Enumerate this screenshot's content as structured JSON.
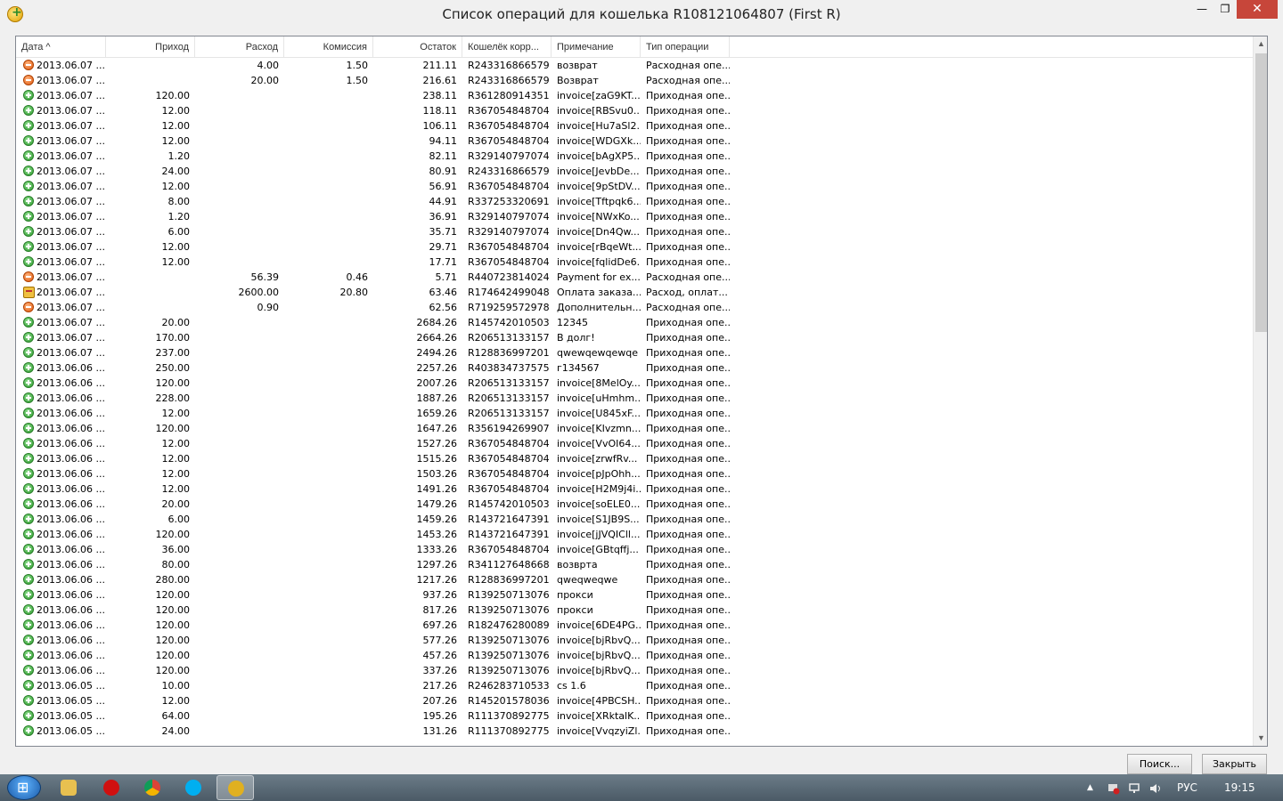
{
  "window": {
    "title": "Список операций для кошелька R108121064807 (First R)",
    "min_glyph": "—",
    "max_glyph": "❐",
    "close_glyph": "✕"
  },
  "columns": {
    "date": "Дата ^",
    "income": "Приход",
    "expense": "Расход",
    "commission": "Комиссия",
    "balance": "Остаток",
    "counterparty": "Кошелёк корр...",
    "note": "Примечание",
    "type": "Тип операции"
  },
  "rows": [
    {
      "icon": "minus",
      "date": "2013.06.07 ...",
      "income": "",
      "expense": "4.00",
      "commission": "1.50",
      "balance": "211.11",
      "wallet": "R243316866579",
      "note": "возврат",
      "type": "Расходная опе..."
    },
    {
      "icon": "minus",
      "date": "2013.06.07 ...",
      "income": "",
      "expense": "20.00",
      "commission": "1.50",
      "balance": "216.61",
      "wallet": "R243316866579",
      "note": "Возврат",
      "type": "Расходная опе..."
    },
    {
      "icon": "plus",
      "date": "2013.06.07 ...",
      "income": "120.00",
      "expense": "",
      "commission": "",
      "balance": "238.11",
      "wallet": "R361280914351",
      "note": "invoice[zaG9KT...",
      "type": "Приходная опе..."
    },
    {
      "icon": "plus",
      "date": "2013.06.07 ...",
      "income": "12.00",
      "expense": "",
      "commission": "",
      "balance": "118.11",
      "wallet": "R367054848704",
      "note": "invoice[RBSvu0...",
      "type": "Приходная опе..."
    },
    {
      "icon": "plus",
      "date": "2013.06.07 ...",
      "income": "12.00",
      "expense": "",
      "commission": "",
      "balance": "106.11",
      "wallet": "R367054848704",
      "note": "invoice[Hu7aSl2...",
      "type": "Приходная опе..."
    },
    {
      "icon": "plus",
      "date": "2013.06.07 ...",
      "income": "12.00",
      "expense": "",
      "commission": "",
      "balance": "94.11",
      "wallet": "R367054848704",
      "note": "invoice[WDGXk...",
      "type": "Приходная опе..."
    },
    {
      "icon": "plus",
      "date": "2013.06.07 ...",
      "income": "1.20",
      "expense": "",
      "commission": "",
      "balance": "82.11",
      "wallet": "R329140797074",
      "note": "invoice[bAgXP5...",
      "type": "Приходная опе..."
    },
    {
      "icon": "plus",
      "date": "2013.06.07 ...",
      "income": "24.00",
      "expense": "",
      "commission": "",
      "balance": "80.91",
      "wallet": "R243316866579",
      "note": "invoice[JevbDe...",
      "type": "Приходная опе..."
    },
    {
      "icon": "plus",
      "date": "2013.06.07 ...",
      "income": "12.00",
      "expense": "",
      "commission": "",
      "balance": "56.91",
      "wallet": "R367054848704",
      "note": "invoice[9pStDV...",
      "type": "Приходная опе..."
    },
    {
      "icon": "plus",
      "date": "2013.06.07 ...",
      "income": "8.00",
      "expense": "",
      "commission": "",
      "balance": "44.91",
      "wallet": "R337253320691",
      "note": "invoice[Tftpqk6...",
      "type": "Приходная опе..."
    },
    {
      "icon": "plus",
      "date": "2013.06.07 ...",
      "income": "1.20",
      "expense": "",
      "commission": "",
      "balance": "36.91",
      "wallet": "R329140797074",
      "note": "invoice[NWxKo...",
      "type": "Приходная опе..."
    },
    {
      "icon": "plus",
      "date": "2013.06.07 ...",
      "income": "6.00",
      "expense": "",
      "commission": "",
      "balance": "35.71",
      "wallet": "R329140797074",
      "note": "invoice[Dn4Qw...",
      "type": "Приходная опе..."
    },
    {
      "icon": "plus",
      "date": "2013.06.07 ...",
      "income": "12.00",
      "expense": "",
      "commission": "",
      "balance": "29.71",
      "wallet": "R367054848704",
      "note": "invoice[rBqeWt...",
      "type": "Приходная опе..."
    },
    {
      "icon": "plus",
      "date": "2013.06.07 ...",
      "income": "12.00",
      "expense": "",
      "commission": "",
      "balance": "17.71",
      "wallet": "R367054848704",
      "note": "invoice[fqlidDe6...",
      "type": "Приходная опе..."
    },
    {
      "icon": "minus",
      "date": "2013.06.07 ...",
      "income": "",
      "expense": "56.39",
      "commission": "0.46",
      "balance": "5.71",
      "wallet": "R440723814024",
      "note": "Payment for ex...",
      "type": "Расходная опе..."
    },
    {
      "icon": "card",
      "date": "2013.06.07 ...",
      "income": "",
      "expense": "2600.00",
      "commission": "20.80",
      "balance": "63.46",
      "wallet": "R174642499048",
      "note": "Оплата заказа...",
      "type": "Расход, оплат..."
    },
    {
      "icon": "minus",
      "date": "2013.06.07 ...",
      "income": "",
      "expense": "0.90",
      "commission": "",
      "balance": "62.56",
      "wallet": "R719259572978",
      "note": "Дополнительн...",
      "type": "Расходная опе..."
    },
    {
      "icon": "plus",
      "date": "2013.06.07 ...",
      "income": "20.00",
      "expense": "",
      "commission": "",
      "balance": "2684.26",
      "wallet": "R145742010503",
      "note": "12345",
      "type": "Приходная опе..."
    },
    {
      "icon": "plus",
      "date": "2013.06.07 ...",
      "income": "170.00",
      "expense": "",
      "commission": "",
      "balance": "2664.26",
      "wallet": "R206513133157",
      "note": "В долг!",
      "type": "Приходная опе..."
    },
    {
      "icon": "plus",
      "date": "2013.06.07 ...",
      "income": "237.00",
      "expense": "",
      "commission": "",
      "balance": "2494.26",
      "wallet": "R128836997201",
      "note": "qwewqewqewqe",
      "type": "Приходная опе..."
    },
    {
      "icon": "plus",
      "date": "2013.06.06 ...",
      "income": "250.00",
      "expense": "",
      "commission": "",
      "balance": "2257.26",
      "wallet": "R403834737575",
      "note": "г134567",
      "type": "Приходная опе..."
    },
    {
      "icon": "plus",
      "date": "2013.06.06 ...",
      "income": "120.00",
      "expense": "",
      "commission": "",
      "balance": "2007.26",
      "wallet": "R206513133157",
      "note": "invoice[8MelOy...",
      "type": "Приходная опе..."
    },
    {
      "icon": "plus",
      "date": "2013.06.06 ...",
      "income": "228.00",
      "expense": "",
      "commission": "",
      "balance": "1887.26",
      "wallet": "R206513133157",
      "note": "invoice[uHmhm...",
      "type": "Приходная опе..."
    },
    {
      "icon": "plus",
      "date": "2013.06.06 ...",
      "income": "12.00",
      "expense": "",
      "commission": "",
      "balance": "1659.26",
      "wallet": "R206513133157",
      "note": "invoice[U845xF...",
      "type": "Приходная опе..."
    },
    {
      "icon": "plus",
      "date": "2013.06.06 ...",
      "income": "120.00",
      "expense": "",
      "commission": "",
      "balance": "1647.26",
      "wallet": "R356194269907",
      "note": "invoice[KIvzmn...",
      "type": "Приходная опе..."
    },
    {
      "icon": "plus",
      "date": "2013.06.06 ...",
      "income": "12.00",
      "expense": "",
      "commission": "",
      "balance": "1527.26",
      "wallet": "R367054848704",
      "note": "invoice[VvOI64...",
      "type": "Приходная опе..."
    },
    {
      "icon": "plus",
      "date": "2013.06.06 ...",
      "income": "12.00",
      "expense": "",
      "commission": "",
      "balance": "1515.26",
      "wallet": "R367054848704",
      "note": "invoice[zrwfRv...",
      "type": "Приходная опе..."
    },
    {
      "icon": "plus",
      "date": "2013.06.06 ...",
      "income": "12.00",
      "expense": "",
      "commission": "",
      "balance": "1503.26",
      "wallet": "R367054848704",
      "note": "invoice[pJpOhh...",
      "type": "Приходная опе..."
    },
    {
      "icon": "plus",
      "date": "2013.06.06 ...",
      "income": "12.00",
      "expense": "",
      "commission": "",
      "balance": "1491.26",
      "wallet": "R367054848704",
      "note": "invoice[H2M9j4i...",
      "type": "Приходная опе..."
    },
    {
      "icon": "plus",
      "date": "2013.06.06 ...",
      "income": "20.00",
      "expense": "",
      "commission": "",
      "balance": "1479.26",
      "wallet": "R145742010503",
      "note": "invoice[soELE0...",
      "type": "Приходная опе..."
    },
    {
      "icon": "plus",
      "date": "2013.06.06 ...",
      "income": "6.00",
      "expense": "",
      "commission": "",
      "balance": "1459.26",
      "wallet": "R143721647391",
      "note": "invoice[S1JB9S...",
      "type": "Приходная опе..."
    },
    {
      "icon": "plus",
      "date": "2013.06.06 ...",
      "income": "120.00",
      "expense": "",
      "commission": "",
      "balance": "1453.26",
      "wallet": "R143721647391",
      "note": "invoice[jJVQICll...",
      "type": "Приходная опе..."
    },
    {
      "icon": "plus",
      "date": "2013.06.06 ...",
      "income": "36.00",
      "expense": "",
      "commission": "",
      "balance": "1333.26",
      "wallet": "R367054848704",
      "note": "invoice[GBtqffj...",
      "type": "Приходная опе..."
    },
    {
      "icon": "plus",
      "date": "2013.06.06 ...",
      "income": "80.00",
      "expense": "",
      "commission": "",
      "balance": "1297.26",
      "wallet": "R341127648668",
      "note": "возврта",
      "type": "Приходная опе..."
    },
    {
      "icon": "plus",
      "date": "2013.06.06 ...",
      "income": "280.00",
      "expense": "",
      "commission": "",
      "balance": "1217.26",
      "wallet": "R128836997201",
      "note": "qweqweqwe",
      "type": "Приходная опе..."
    },
    {
      "icon": "plus",
      "date": "2013.06.06 ...",
      "income": "120.00",
      "expense": "",
      "commission": "",
      "balance": "937.26",
      "wallet": "R139250713076",
      "note": "прокси",
      "type": "Приходная опе..."
    },
    {
      "icon": "plus",
      "date": "2013.06.06 ...",
      "income": "120.00",
      "expense": "",
      "commission": "",
      "balance": "817.26",
      "wallet": "R139250713076",
      "note": "прокси",
      "type": "Приходная опе..."
    },
    {
      "icon": "plus",
      "date": "2013.06.06 ...",
      "income": "120.00",
      "expense": "",
      "commission": "",
      "balance": "697.26",
      "wallet": "R182476280089",
      "note": "invoice[6DE4PG...",
      "type": "Приходная опе..."
    },
    {
      "icon": "plus",
      "date": "2013.06.06 ...",
      "income": "120.00",
      "expense": "",
      "commission": "",
      "balance": "577.26",
      "wallet": "R139250713076",
      "note": "invoice[bjRbvQ...",
      "type": "Приходная опе..."
    },
    {
      "icon": "plus",
      "date": "2013.06.06 ...",
      "income": "120.00",
      "expense": "",
      "commission": "",
      "balance": "457.26",
      "wallet": "R139250713076",
      "note": "invoice[bjRbvQ...",
      "type": "Приходная опе..."
    },
    {
      "icon": "plus",
      "date": "2013.06.06 ...",
      "income": "120.00",
      "expense": "",
      "commission": "",
      "balance": "337.26",
      "wallet": "R139250713076",
      "note": "invoice[bjRbvQ...",
      "type": "Приходная опе..."
    },
    {
      "icon": "plus",
      "date": "2013.06.05 ...",
      "income": "10.00",
      "expense": "",
      "commission": "",
      "balance": "217.26",
      "wallet": "R246283710533",
      "note": "cs 1.6",
      "type": "Приходная опе..."
    },
    {
      "icon": "plus",
      "date": "2013.06.05 ...",
      "income": "12.00",
      "expense": "",
      "commission": "",
      "balance": "207.26",
      "wallet": "R145201578036",
      "note": "invoice[4PBCSH...",
      "type": "Приходная опе..."
    },
    {
      "icon": "plus",
      "date": "2013.06.05 ...",
      "income": "64.00",
      "expense": "",
      "commission": "",
      "balance": "195.26",
      "wallet": "R111370892775",
      "note": "invoice[XRktalK...",
      "type": "Приходная опе..."
    },
    {
      "icon": "plus",
      "date": "2013.06.05 ...",
      "income": "24.00",
      "expense": "",
      "commission": "",
      "balance": "131.26",
      "wallet": "R111370892775",
      "note": "invoice[VvqzyiZl...",
      "type": "Приходная опе..."
    }
  ],
  "buttons": {
    "search": "Поиск...",
    "close": "Закрыть"
  },
  "scrollbar": {
    "up": "▲",
    "down": "▼"
  },
  "taskbar": {
    "lang": "РУС",
    "time": "19:15",
    "tray_arrow": "▲"
  }
}
